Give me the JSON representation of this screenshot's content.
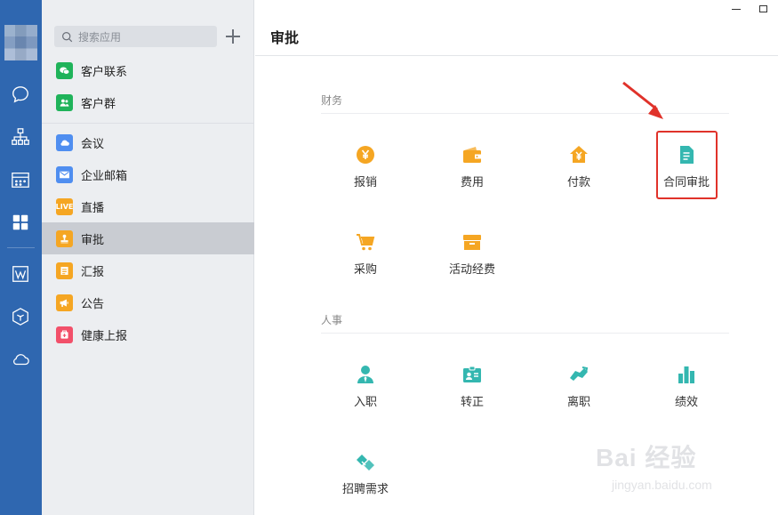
{
  "rail": {
    "icons": [
      "chat-icon",
      "org-chart-icon",
      "calendar-icon",
      "workbench-icon",
      "doc-icon",
      "cube-icon",
      "cloud-icon"
    ],
    "bg": "#2f67b0"
  },
  "applist": {
    "search_placeholder": "搜索应用",
    "items": [
      {
        "label": "客户联系",
        "color": "#1fb35a",
        "icon": "wechat-icon"
      },
      {
        "label": "客户群",
        "color": "#1fb35a",
        "icon": "group-icon"
      },
      {
        "label": "会议",
        "color": "#4f8ef0",
        "icon": "cloud-meeting-icon"
      },
      {
        "label": "企业邮箱",
        "color": "#4f8ef0",
        "icon": "mail-icon"
      },
      {
        "label": "直播",
        "color": "#f5a623",
        "icon": "live-icon",
        "badge": "LIVE"
      },
      {
        "label": "审批",
        "color": "#f5a623",
        "icon": "stamp-icon",
        "active": true
      },
      {
        "label": "汇报",
        "color": "#f5a623",
        "icon": "report-icon"
      },
      {
        "label": "公告",
        "color": "#f5a623",
        "icon": "megaphone-icon"
      },
      {
        "label": "健康上报",
        "color": "#f2506a",
        "icon": "health-icon"
      }
    ]
  },
  "main": {
    "title": "审批",
    "sections": [
      {
        "label": "财务",
        "tiles": [
          {
            "label": "报销",
            "icon": "yen-coin-icon",
            "color": "#f5a623"
          },
          {
            "label": "费用",
            "icon": "wallet-icon",
            "color": "#f5a623"
          },
          {
            "label": "付款",
            "icon": "yen-house-icon",
            "color": "#f5a623"
          },
          {
            "label": "合同审批",
            "icon": "contract-doc-icon",
            "color": "#34b7b0",
            "highlighted": true
          },
          {
            "label": "采购",
            "icon": "cart-icon",
            "color": "#f5a623"
          },
          {
            "label": "活动经费",
            "icon": "event-box-icon",
            "color": "#f5a623"
          }
        ]
      },
      {
        "label": "人事",
        "tiles": [
          {
            "label": "入职",
            "icon": "person-tie-icon",
            "color": "#34b7b0"
          },
          {
            "label": "转正",
            "icon": "badge-card-icon",
            "color": "#34b7b0"
          },
          {
            "label": "离职",
            "icon": "handshake-leave-icon",
            "color": "#34b7b0"
          },
          {
            "label": "绩效",
            "icon": "bar-chart-icon",
            "color": "#34b7b0"
          },
          {
            "label": "招聘需求",
            "icon": "handshake-icon",
            "color": "#34b7b0"
          }
        ]
      }
    ],
    "highlight_color": "#e0322a"
  },
  "watermark": {
    "big": "Bai 经验",
    "small": "jingyan.baidu.com"
  }
}
